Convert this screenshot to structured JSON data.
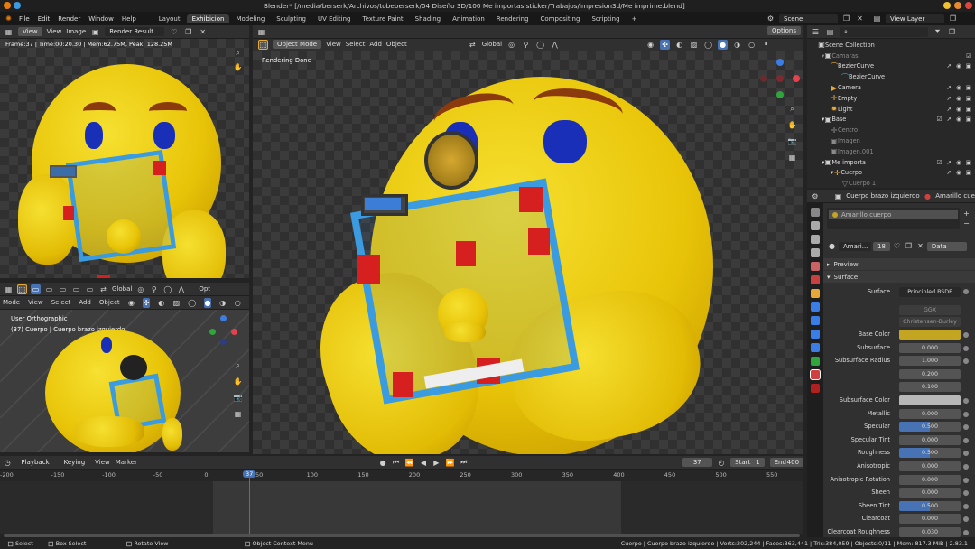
{
  "titlebar": {
    "title": "Blender* [/media/berserk/Archivos/tobeberserk/04 Diseño 3D/100 Me importas sticker/Trabajos/impresion3d/Me imprime.blend]"
  },
  "menubar": {
    "menus": [
      "File",
      "Edit",
      "Render",
      "Window",
      "Help"
    ],
    "workspaces": [
      "Layout",
      "Exhibicion",
      "Modeling",
      "Sculpting",
      "UV Editing",
      "Texture Paint",
      "Shading",
      "Animation",
      "Rendering",
      "Compositing",
      "Scripting"
    ],
    "active_workspace": "Exhibicion",
    "scene": "Scene",
    "view_layer": "View Layer"
  },
  "image_editor": {
    "menus": [
      "View",
      "View",
      "Image"
    ],
    "image_name": "Render Result",
    "stats": "Frame:37 | Time:00:20.30 | Mem:62.75M, Peak: 128.25M"
  },
  "small_viewport": {
    "global": "Global",
    "opt": "Opt",
    "menus": [
      "Mode",
      "View",
      "Select",
      "Add",
      "Object"
    ],
    "view_name": "User Orthographic",
    "object_info": "(37) Cuerpo | Cuerpo brazo izquierdo"
  },
  "main_viewport": {
    "mode": "Object Mode",
    "menus": [
      "View",
      "Select",
      "Add",
      "Object"
    ],
    "orientation": "Global",
    "options": "Options",
    "status": "Rendering Done"
  },
  "outliner": {
    "search_placeholder": "",
    "rows": [
      {
        "label": "Scene Collection",
        "indent": 0,
        "dim": false
      },
      {
        "label": "Camaras",
        "indent": 1,
        "dim": true
      },
      {
        "label": "BezierCurve",
        "indent": 2,
        "dim": false
      },
      {
        "label": "BezierCurve",
        "indent": 3,
        "dim": false
      },
      {
        "label": "Camera",
        "indent": 2,
        "dim": false
      },
      {
        "label": "Empty",
        "indent": 2,
        "dim": false
      },
      {
        "label": "Light",
        "indent": 2,
        "dim": false
      },
      {
        "label": "Base",
        "indent": 1,
        "dim": false
      },
      {
        "label": "Centro",
        "indent": 2,
        "dim": true
      },
      {
        "label": "Imagen",
        "indent": 2,
        "dim": true
      },
      {
        "label": "Imagen.001",
        "indent": 2,
        "dim": true
      },
      {
        "label": "Me importa",
        "indent": 1,
        "dim": false
      },
      {
        "label": "Cuerpo",
        "indent": 2,
        "dim": false
      },
      {
        "label": "Cuerpo 1",
        "indent": 3,
        "dim": true
      }
    ]
  },
  "properties": {
    "object": "Cuerpo brazo izquierdo",
    "material_tab": "Amarillo cue",
    "slot": "Amarillo cuerpo",
    "material_short": "Amari...",
    "users": "18",
    "data": "Data",
    "preview": "Preview",
    "surface": "Surface",
    "surface_label": "Surface",
    "surface_value": "Principled BSDF",
    "distribution": "GGX",
    "sss_method": "Christensen-Burley",
    "params": [
      {
        "label": "Base Color",
        "value": "",
        "type": "color",
        "color": "#c4a522"
      },
      {
        "label": "Subsurface",
        "value": "0.000",
        "type": "num"
      },
      {
        "label": "Subsurface Radius",
        "value": "1.000",
        "type": "num"
      },
      {
        "label": "",
        "value": "0.200",
        "type": "num"
      },
      {
        "label": "",
        "value": "0.100",
        "type": "num"
      },
      {
        "label": "Subsurface Color",
        "value": "",
        "type": "color",
        "color": "#b8b8b8"
      },
      {
        "label": "Metallic",
        "value": "0.000",
        "type": "num"
      },
      {
        "label": "Specular",
        "value": "0.500",
        "type": "blue"
      },
      {
        "label": "Specular Tint",
        "value": "0.000",
        "type": "num"
      },
      {
        "label": "Roughness",
        "value": "0.500",
        "type": "blue"
      },
      {
        "label": "Anisotropic",
        "value": "0.000",
        "type": "num"
      },
      {
        "label": "Anisotropic Rotation",
        "value": "0.000",
        "type": "num"
      },
      {
        "label": "Sheen",
        "value": "0.000",
        "type": "num"
      },
      {
        "label": "Sheen Tint",
        "value": "0.500",
        "type": "blue"
      },
      {
        "label": "Clearcoat",
        "value": "0.000",
        "type": "num"
      },
      {
        "label": "Clearcoat Roughness",
        "value": "0.030",
        "type": "num"
      }
    ]
  },
  "timeline": {
    "menus": [
      "Playback",
      "Keying",
      "View",
      "Marker"
    ],
    "current_frame": "37",
    "start_label": "Start",
    "start": "1",
    "end_label": "End",
    "end": "400",
    "ticks": [
      "-200",
      "-150",
      "-100",
      "-50",
      "0",
      "50",
      "100",
      "150",
      "200",
      "250",
      "300",
      "350",
      "400",
      "450",
      "500",
      "550"
    ]
  },
  "statusbar": {
    "hints": [
      "Select",
      "Box Select",
      "Rotate View",
      "Object Context Menu"
    ],
    "stats": "Cuerpo | Cuerpo brazo izquierdo | Verts:202,244 | Faces:363,441 | Tris:384,059 | Objects:0/11 | Mem: 817.3 MiB | 2.83.1"
  },
  "colors": {
    "accent": "#4772b3",
    "emoji_yellow": "#eccc10",
    "eye_blue": "#1a2fb8",
    "frame_red": "#d62020",
    "frame_blue": "#3a9be0"
  }
}
